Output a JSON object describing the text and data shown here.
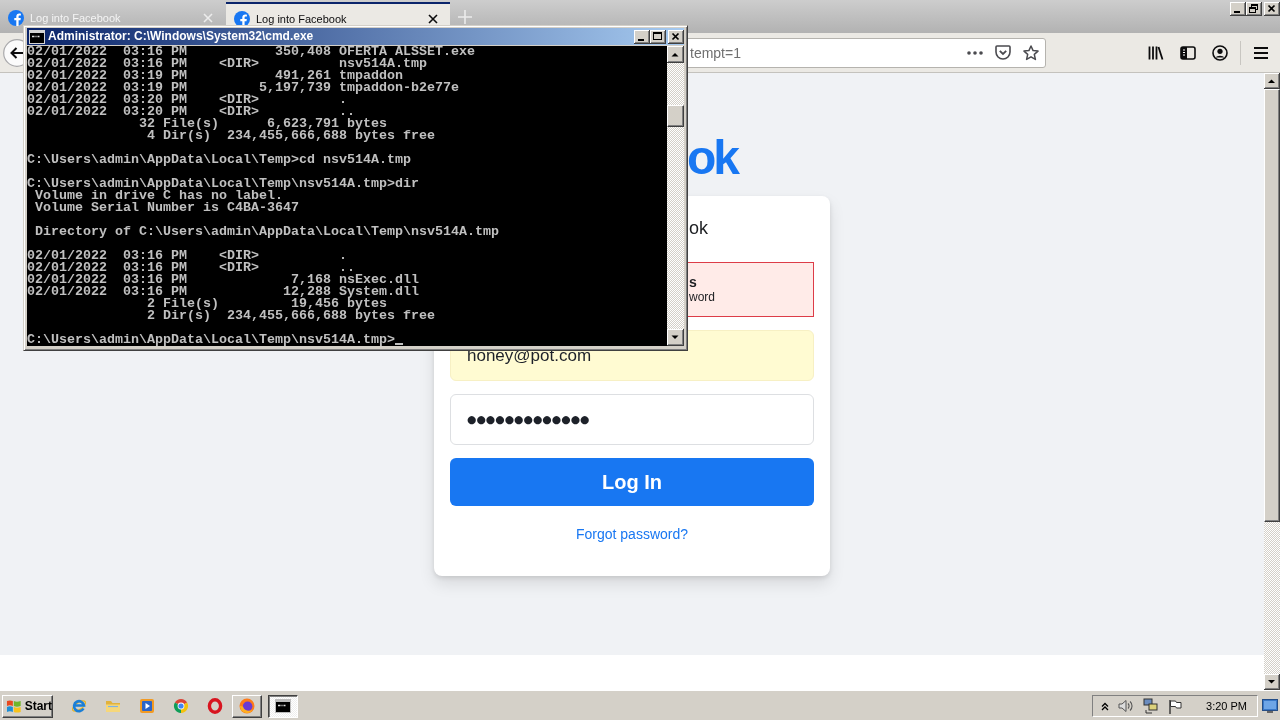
{
  "browser": {
    "tabs": [
      {
        "title": "Log into Facebook",
        "selected": false
      },
      {
        "title": "Log into Facebook",
        "selected": true
      }
    ],
    "address_bar": {
      "value": "tempt=1"
    },
    "page": {
      "logo": "ok",
      "card": {
        "heading": "ok",
        "error": {
          "title": "s",
          "message": "word"
        },
        "email": {
          "value": "honey@pot.com",
          "autofilled": true
        },
        "password": {
          "value": "●●●●●●●●●●●●●"
        },
        "login_button": "Log In",
        "forgot_password": "Forgot password?"
      }
    }
  },
  "console_window": {
    "title": "Administrator: C:\\Windows\\System32\\cmd.exe",
    "blocks": [
      [
        "02/01/2022  03:16 PM           350,408 OFERTA ALSSET.exe",
        "02/01/2022  03:16 PM    <DIR>          nsv514A.tmp",
        "02/01/2022  03:19 PM           491,261 tmpaddon",
        "02/01/2022  03:19 PM         5,197,739 tmpaddon-b2e77e",
        "02/01/2022  03:20 PM    <DIR>          .",
        "02/01/2022  03:20 PM    <DIR>          ..",
        "              32 File(s)      6,623,791 bytes",
        "               4 Dir(s)  234,455,666,688 bytes free"
      ],
      [
        "C:\\Users\\admin\\AppData\\Local\\Temp>cd nsv514A.tmp"
      ],
      [
        "C:\\Users\\admin\\AppData\\Local\\Temp\\nsv514A.tmp>dir",
        " Volume in drive C has no label.",
        " Volume Serial Number is C4BA-3647"
      ],
      [
        " Directory of C:\\Users\\admin\\AppData\\Local\\Temp\\nsv514A.tmp"
      ],
      [
        "02/01/2022  03:16 PM    <DIR>          .",
        "02/01/2022  03:16 PM    <DIR>          ..",
        "02/01/2022  03:16 PM             7,168 nsExec.dll",
        "02/01/2022  03:16 PM            12,288 System.dll",
        "               2 File(s)         19,456 bytes",
        "               2 Dir(s)  234,455,666,688 bytes free"
      ],
      [
        "C:\\Users\\admin\\AppData\\Local\\Temp\\nsv514A.tmp>"
      ]
    ],
    "cursor": true
  },
  "taskbar": {
    "start": "Start",
    "tasks": [
      {
        "kind": "browser",
        "selected": false
      },
      {
        "kind": "console",
        "selected": true
      }
    ],
    "clock": "3:20 PM"
  }
}
